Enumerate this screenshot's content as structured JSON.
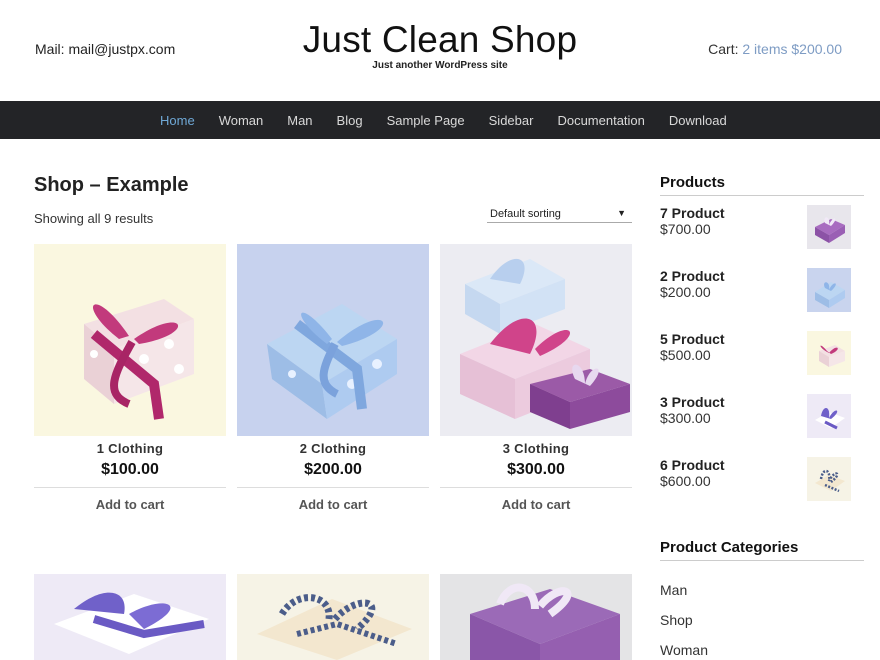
{
  "header": {
    "mail": "Mail: mail@justpx.com",
    "site_title": "Just Clean Shop",
    "tagline": "Just another WordPress site",
    "cart_label": "Cart:",
    "cart_summary": "2 items $200.00"
  },
  "nav": {
    "items": [
      "Home",
      "Woman",
      "Man",
      "Blog",
      "Sample Page",
      "Sidebar",
      "Documentation",
      "Download"
    ],
    "active": "Home"
  },
  "shop": {
    "title": "Shop – Example",
    "result_count": "Showing all 9 results",
    "sorting": "Default sorting",
    "add_to_cart": "Add to cart",
    "products": [
      {
        "name": "1 Clothing",
        "price": "$100.00"
      },
      {
        "name": "2 Clothing",
        "price": "$200.00"
      },
      {
        "name": "3 Clothing",
        "price": "$300.00"
      }
    ]
  },
  "sidebar": {
    "products_title": "Products",
    "products": [
      {
        "name": "7 Product",
        "price": "$700.00"
      },
      {
        "name": "2 Product",
        "price": "$200.00"
      },
      {
        "name": "5 Product",
        "price": "$500.00"
      },
      {
        "name": "3 Product",
        "price": "$300.00"
      },
      {
        "name": "6 Product",
        "price": "$600.00"
      }
    ],
    "categories_title": "Product Categories",
    "categories": [
      "Man",
      "Shop",
      "Woman"
    ]
  },
  "colors": {
    "nav_bg": "#232427",
    "nav_active": "#6fa8d6",
    "cart_link": "#7e9cc4"
  }
}
